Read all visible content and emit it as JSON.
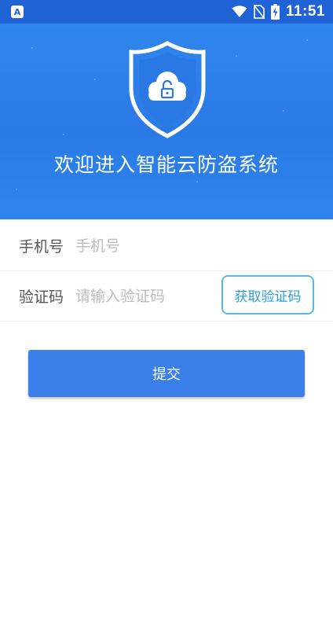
{
  "status_bar": {
    "app_badge": "A",
    "time": "11:51",
    "icons": [
      "wifi-icon",
      "no-sim-icon",
      "battery-charging-icon"
    ]
  },
  "banner": {
    "logo_icon": "shield-cloud-lock-icon",
    "title": "欢迎进入智能云防盗系统"
  },
  "form": {
    "phone": {
      "label": "手机号",
      "placeholder": "手机号",
      "value": ""
    },
    "code": {
      "label": "验证码",
      "placeholder": "请输入验证码",
      "value": "",
      "get_code_label": "获取验证码"
    },
    "submit_label": "提交"
  },
  "colors": {
    "status_bar": "#1f63d6",
    "banner": "#2f86ec",
    "primary_button": "#3b7fe8",
    "outline_button": "#5cb6e4"
  }
}
